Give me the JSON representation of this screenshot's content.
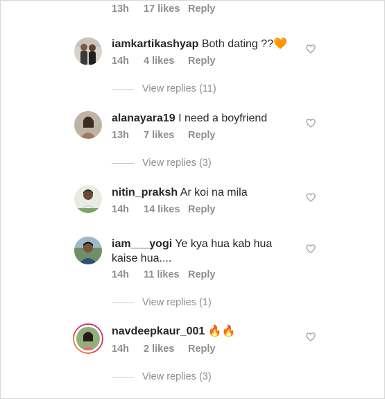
{
  "top_meta": {
    "time": "13h",
    "likes": "17 likes",
    "reply": "Reply"
  },
  "comments": [
    {
      "username": "iamkartikashyap",
      "text": "Both dating ??",
      "emoji": "🧡",
      "time": "14h",
      "likes": "4 likes",
      "reply": "Reply",
      "view_replies": "View replies (11)",
      "avatar_icon": "avatar-two-people"
    },
    {
      "username": "alanayara19",
      "text": "I need a boyfriend",
      "time": "13h",
      "likes": "7 likes",
      "reply": "Reply",
      "view_replies": "View replies (3)",
      "avatar_icon": "avatar-woman"
    },
    {
      "username": "nitin_praksh",
      "text": "Ar koi na mila",
      "time": "14h",
      "likes": "14 likes",
      "reply": "Reply",
      "view_replies": "",
      "avatar_icon": "avatar-man"
    },
    {
      "username": "iam___yogi",
      "text": "Ye kya hua kab hua kaise hua....",
      "time": "14h",
      "likes": "11 likes",
      "reply": "Reply",
      "view_replies": "View replies (1)",
      "avatar_icon": "avatar-man-outdoor"
    },
    {
      "username": "navdeepkaur_001",
      "text": "",
      "emoji": "🔥🔥",
      "time": "14h",
      "likes": "2 likes",
      "reply": "Reply",
      "view_replies": "View replies (3)",
      "avatar_icon": "avatar-woman-story-ring"
    }
  ],
  "colors": {
    "text": "#262626",
    "meta": "#8e8e8e",
    "heart": "#9a9a9a",
    "story_ring": "#c13584",
    "emoji_orange": "#f28b1e"
  }
}
